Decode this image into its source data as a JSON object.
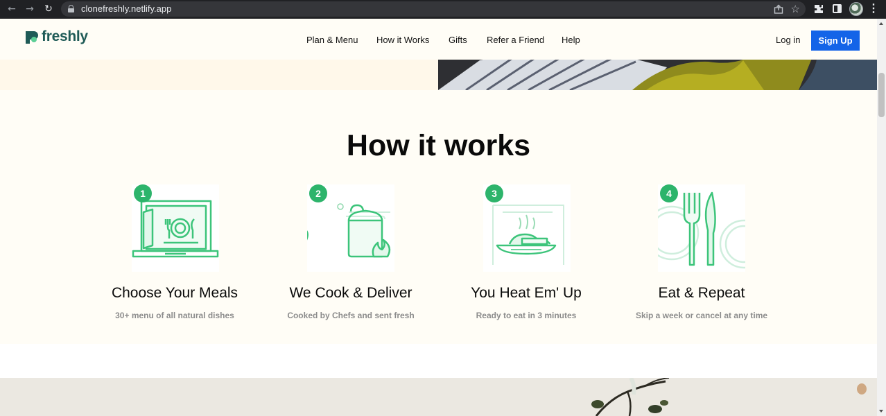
{
  "browser": {
    "url": "clonefreshly.netlify.app",
    "icons": [
      "back-arrow-icon",
      "forward-arrow-icon",
      "reload-icon",
      "lock-icon",
      "share-icon",
      "star-icon",
      "extensions-icon",
      "side-panel-icon",
      "profile-avatar",
      "kebab-menu-icon"
    ]
  },
  "nav": {
    "brand": "freshly",
    "links": [
      "Plan & Menu",
      "How it Works",
      "Gifts",
      "Refer a Friend",
      "Help"
    ],
    "login": "Log in",
    "signup": "Sign Up"
  },
  "how_it_works": {
    "title": "How it works",
    "steps": [
      {
        "number": "1",
        "title": "Choose Your Meals",
        "subtitle": "30+ menu of all natural dishes",
        "icon": "laptop-meal-icon"
      },
      {
        "number": "2",
        "title": "We Cook & Deliver",
        "subtitle": "Cooked by Chefs and sent fresh",
        "icon": "cooking-pot-icon"
      },
      {
        "number": "3",
        "title": "You Heat Em' Up",
        "subtitle": "Ready to eat in 3 minutes",
        "icon": "microwave-plate-icon"
      },
      {
        "number": "4",
        "title": "Eat & Repeat",
        "subtitle": "Skip a week or cancel at any time",
        "icon": "fork-knife-icon"
      }
    ]
  },
  "colors": {
    "brand": "#1f5b57",
    "accent_green": "#2db46b",
    "signup_blue": "#1464e8",
    "cream": "#fffdf6"
  }
}
